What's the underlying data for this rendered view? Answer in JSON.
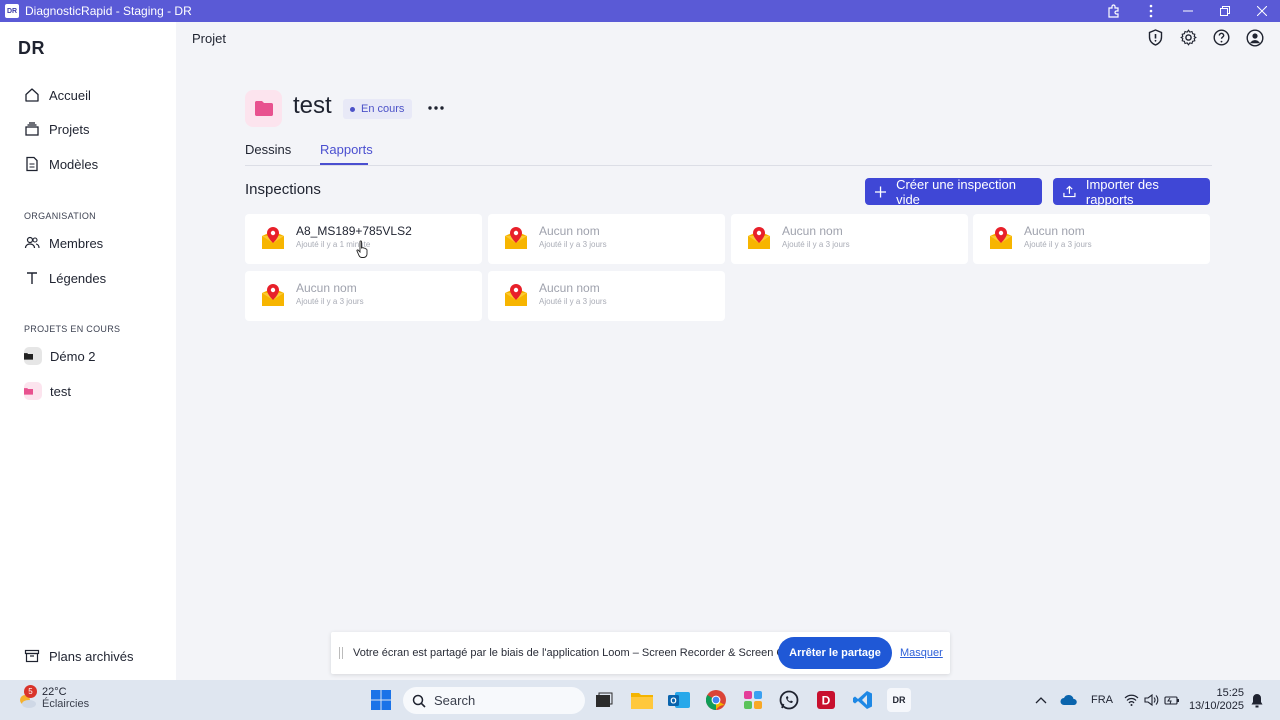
{
  "window": {
    "title": "DiagnosticRapid - Staging - DR",
    "logo": "DR"
  },
  "sidebar": {
    "brand": "DR",
    "items": [
      {
        "label": "Accueil",
        "icon": "home-icon"
      },
      {
        "label": "Projets",
        "icon": "layers-icon"
      },
      {
        "label": "Modèles",
        "icon": "document-icon"
      }
    ],
    "org_label": "ORGANISATION",
    "org_items": [
      {
        "label": "Membres",
        "icon": "users-icon"
      },
      {
        "label": "Légendes",
        "icon": "text-icon"
      }
    ],
    "projects_label": "PROJETS EN COURS",
    "projects": [
      {
        "label": "Démo 2",
        "color": "#222222"
      },
      {
        "label": "test",
        "color": "#e8528f"
      }
    ],
    "archived": "Plans archivés"
  },
  "header": {
    "breadcrumb": "Projet",
    "icons": [
      "shield-icon",
      "gear-icon",
      "help-icon",
      "account-icon"
    ]
  },
  "project": {
    "title": "test",
    "status": "En cours",
    "tabs": [
      {
        "label": "Dessins",
        "active": false
      },
      {
        "label": "Rapports",
        "active": true
      }
    ]
  },
  "inspections": {
    "title": "Inspections",
    "create_label": "Créer une inspection vide",
    "import_label": "Importer des rapports",
    "cards": [
      {
        "name": "A8_MS189+785VLS2",
        "added": "Ajouté il y a 1 minute"
      },
      {
        "name": "Aucun nom",
        "added": "Ajouté il y a 3 jours"
      },
      {
        "name": "Aucun nom",
        "added": "Ajouté il y a 3 jours"
      },
      {
        "name": "Aucun nom",
        "added": "Ajouté il y a 3 jours"
      },
      {
        "name": "Aucun nom",
        "added": "Ajouté il y a 3 jours"
      },
      {
        "name": "Aucun nom",
        "added": "Ajouté il y a 3 jours"
      }
    ]
  },
  "loom_banner": {
    "message": "Votre écran est partagé par le biais de l'application Loom – Screen Recorder & Screen Capture.",
    "stop_label": "Arrêter le partage",
    "hide_label": "Masquer"
  },
  "taskbar": {
    "weather_badge": "5",
    "temperature": "22°C",
    "weather_desc": "Éclaircies",
    "search_placeholder": "Search",
    "language": "FRA",
    "time": "15:25",
    "date": "13/10/2025"
  },
  "colors": {
    "accent": "#3f47d6",
    "title_bar": "#5a5ad6",
    "project_pink": "#e8528f"
  }
}
